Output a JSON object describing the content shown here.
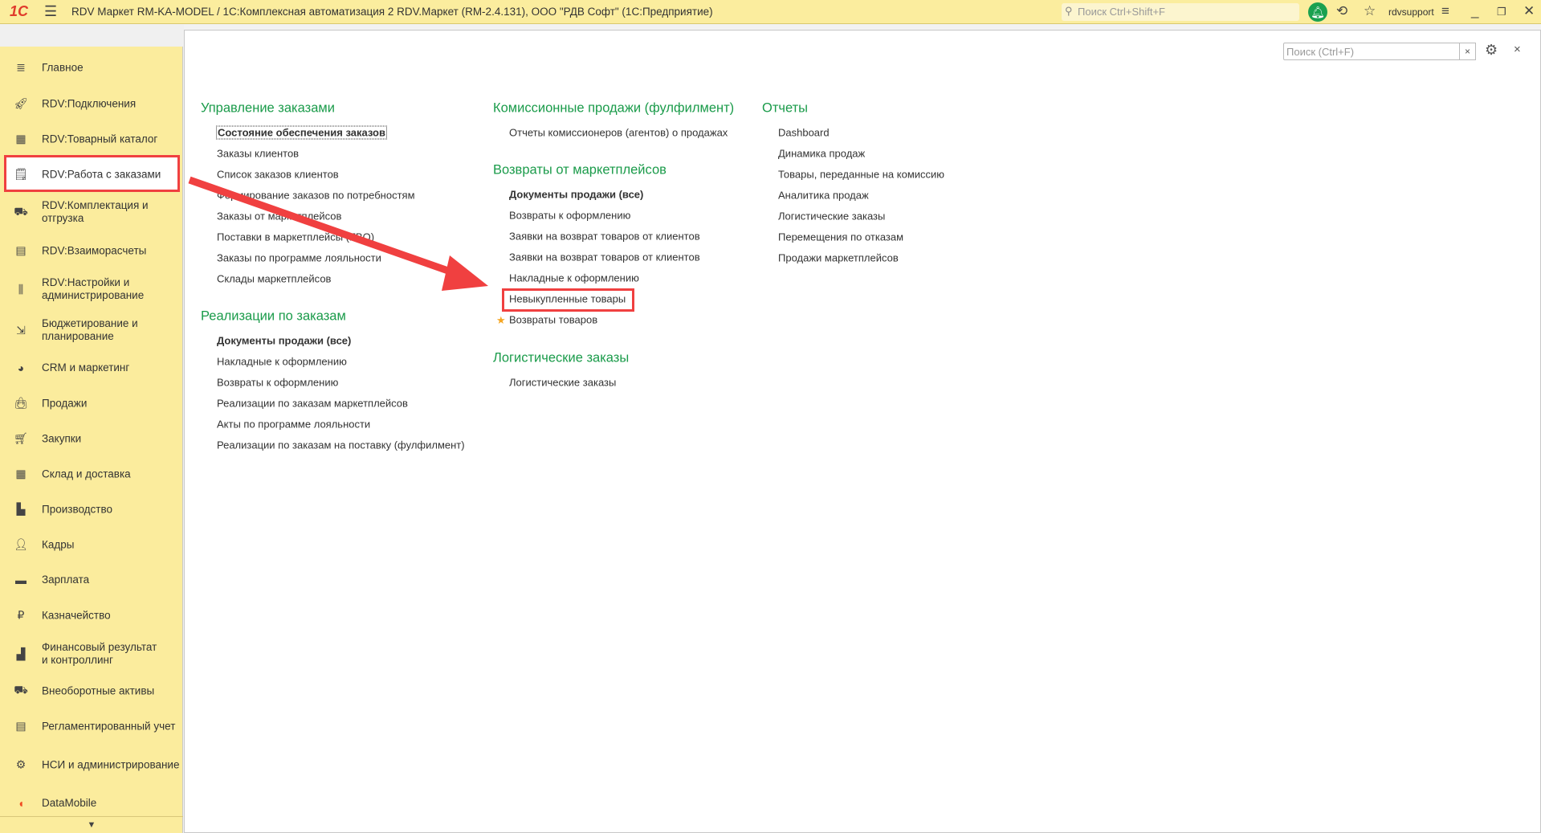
{
  "titlebar": {
    "logo": "1С",
    "title": "RDV Маркет RM-KA-MODEL / 1С:Комплексная автоматизация 2 RDV.Маркет (RM-2.4.131), ООО \"РДВ Софт\"  (1С:Предприятие)",
    "search_placeholder": "Поиск Ctrl+Shift+F",
    "user": "rdvsupport"
  },
  "sidebar": {
    "items": [
      {
        "label": "Главное",
        "icon": "menu-lines-icon"
      },
      {
        "label": "RDV:Подключения",
        "icon": "rocket-icon"
      },
      {
        "label": "RDV:Товарный каталог",
        "icon": "grid-icon"
      },
      {
        "label": "RDV:Работа с заказами",
        "icon": "orders-doc-icon",
        "selected": true
      },
      {
        "label": "RDV:Комплектация и отгрузка",
        "icon": "cart-boxes-icon"
      },
      {
        "label": "RDV:Взаиморасчеты",
        "icon": "calculator-icon"
      },
      {
        "label": "RDV:Настройки и администрирование",
        "icon": "sliders-icon"
      },
      {
        "label": "Бюджетирование и планирование",
        "icon": "budget-chart-icon"
      },
      {
        "label": "CRM и маркетинг",
        "icon": "pie-icon"
      },
      {
        "label": "Продажи",
        "icon": "bag-icon"
      },
      {
        "label": "Закупки",
        "icon": "cart-icon"
      },
      {
        "label": "Склад и доставка",
        "icon": "warehouse-icon"
      },
      {
        "label": "Производство",
        "icon": "factory-icon"
      },
      {
        "label": "Кадры",
        "icon": "person-icon"
      },
      {
        "label": "Зарплата",
        "icon": "card-icon"
      },
      {
        "label": "Казначейство",
        "icon": "ruble-icon"
      },
      {
        "label": "Финансовый результат и контроллинг",
        "icon": "bar-chart-icon"
      },
      {
        "label": "Внеоборотные активы",
        "icon": "truck-icon"
      },
      {
        "label": "Регламентированный учет",
        "icon": "report-calc-icon"
      },
      {
        "label": "НСИ и администрирование",
        "icon": "gear-icon"
      },
      {
        "label": "DataMobile",
        "icon": "datamobile-logo-icon"
      }
    ]
  },
  "panel": {
    "search_placeholder": "Поиск (Ctrl+F)",
    "clear": "×",
    "close": "×"
  },
  "sections": [
    {
      "title": "Управление заказами",
      "links": [
        "Состояние обеспечения заказов",
        "Заказы клиентов",
        "Список заказов клиентов",
        "Формирование заказов по потребностям",
        "Заказы от маркетплейсов",
        "Поставки в маркетплейсы (FBO)",
        "Заказы по программе лояльности",
        "Склады маркетплейсов"
      ]
    },
    {
      "title": "Реализации по заказам",
      "links": [
        "Документы продажи (все)",
        "Накладные к оформлению",
        "Возвраты к оформлению",
        "Реализации по заказам маркетплейсов",
        "Акты по программе лояльности",
        "Реализации по заказам на поставку (фулфилмент)"
      ]
    },
    {
      "title": "Комиссионные продажи (фулфилмент)",
      "links": [
        "Отчеты комиссионеров (агентов) о продажах"
      ]
    },
    {
      "title": "Возвраты от маркетплейсов",
      "links": [
        "Документы продажи (все)",
        "Возвраты к оформлению",
        "Заявки на возврат товаров от клиентов",
        "Заявки на возврат товаров от клиентов",
        "Накладные к оформлению",
        "Невыкупленные товары",
        "Возвраты товаров"
      ]
    },
    {
      "title": "Логистические заказы",
      "links": [
        "Логистические заказы"
      ]
    },
    {
      "title": "Отчеты",
      "links": [
        "Dashboard",
        "Динамика продаж",
        "Товары, переданные на комиссию",
        "Аналитика продаж",
        "Логистические заказы",
        "Перемещения по отказам",
        "Продажи маркетплейсов"
      ]
    }
  ],
  "colors": {
    "accent": "#1a9b4a",
    "highlight": "#f04040",
    "topbar": "#fbed9e"
  }
}
